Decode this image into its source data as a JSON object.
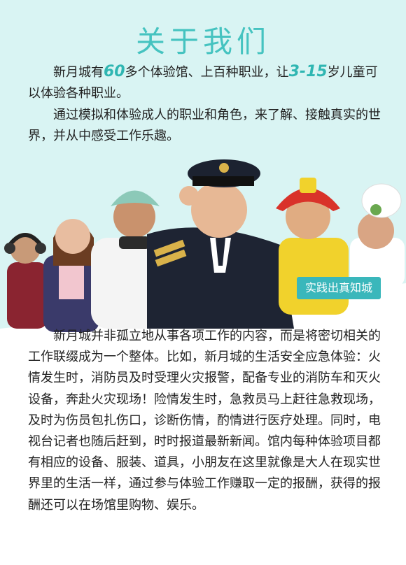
{
  "title": "关于我们",
  "intro": {
    "p1_part1": "新月城有",
    "p1_num1": "60",
    "p1_part2": "多个体验馆、上百种职业，让",
    "p1_num2": "3-15",
    "p1_part3": "岁儿童可以体验各种职业。",
    "p2": "通过模拟和体验成人的职业和角色，来了解、接触真实的世界，并从中感受工作乐趣。"
  },
  "photo": {
    "badge": "实践出真知城"
  },
  "body": {
    "p3": "新月城并非孤立地从事各项工作的内容，而是将密切相关的工作联缀成为一个整体。比如，新月城的生活安全应急体验：火情发生时，消防员及时受理火灾报警，配备专业的消防车和灭火设备，奔赴火灾现场！险情发生时，急救员马上赶往急救现场，及时为伤员包扎伤口，诊断伤情，酌情进行医疗处理。同时，电视台记者也随后赶到，时时报道最新新闻。馆内每种体验项目都有相应的设备、服装、道具，小朋友在这里就像是大人在现实世界里的生活一样，通过参与体验工作赚取一定的报酬，获得的报酬还可以在场馆里购物、娱乐。"
  },
  "colors": {
    "accent": "#45c3c0",
    "badge": "#3ab7bb",
    "top_bg": "#d9f4f3"
  }
}
